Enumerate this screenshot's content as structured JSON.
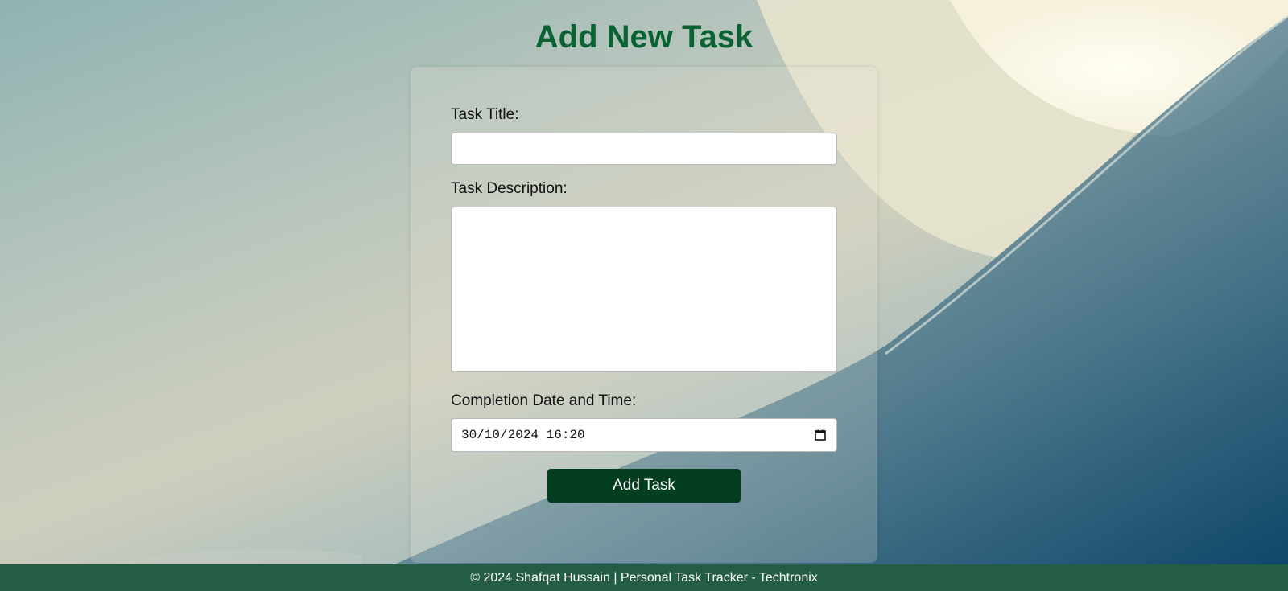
{
  "page": {
    "title": "Add New Task"
  },
  "form": {
    "title_label": "Task Title:",
    "title_value": "",
    "description_label": "Task Description:",
    "description_value": "",
    "date_label": "Completion Date and Time:",
    "date_value": "30/10/2024 16:20",
    "date_icon": "calendar-icon",
    "submit_label": "Add Task"
  },
  "footer": {
    "text": "© 2024 Shafqat Hussain | Personal Task Tracker - Techtronix"
  },
  "colors": {
    "title": "#0b6333",
    "button": "#023e1f",
    "footer": "#235e44"
  }
}
